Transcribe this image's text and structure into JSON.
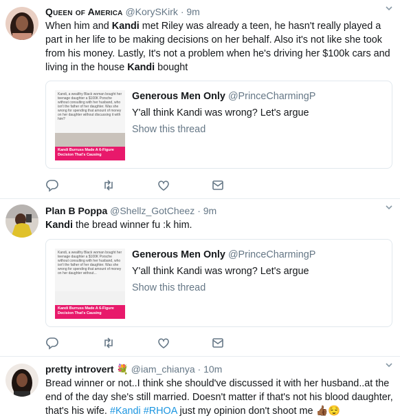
{
  "tweets": [
    {
      "name": "Queen of America",
      "handle": "@KorySKirk",
      "dot": "·",
      "time": "9m",
      "text_parts": [
        "When him and ",
        "Kandi",
        " met Riley was already a teen, he hasn't really played a part in her life to be making decisions on her behalf. Also it's not like she took from his money. Lastly, It's not a problem when he's driving her $100k cars and living in the house ",
        "Kandi",
        " bought"
      ],
      "quote": {
        "name": "Generous Men Only",
        "handle": "@PrinceCharmingP",
        "text": "Y'all think Kandi was wrong? Let's argue",
        "thread_link": "Show this thread",
        "thumb_text": "Kandi, a wealthy Black woman bought her teenage daughter a $100K Porsche without consulting with her husband, who isn't the father of her daughter. Was she wrong for spending that amount of money on her daughter without discussing it with him?",
        "thumb_banner": "Kandi Burruss Made A 6-Figure Decision That's Causing"
      }
    },
    {
      "name": "Plan B Poppa",
      "handle": "@Shellz_GotCheez",
      "dot": "·",
      "time": "9m",
      "text_parts": [
        "Kandi",
        " the bread winner fu :k him."
      ],
      "quote": {
        "name": "Generous Men Only",
        "handle": "@PrinceCharmingP",
        "text": "Y'all think Kandi was wrong? Let's argue",
        "thread_link": "Show this thread",
        "thumb_text": "Kandi, a wealthy Black woman bought her teenage daughter a $100K Porsche without consulting with her husband, who isn't the father of her daughter. Was she wrong for spending that amount of money on her daughter without...",
        "thumb_banner": "Kandi Burruss Made A 6-Figure Decision That's Causing"
      }
    },
    {
      "name": "pretty introvert",
      "emoji": "💐",
      "handle": "@iam_chianya",
      "dot": "·",
      "time": "10m",
      "text_parts": [
        "Bread winner or not..I think she should've discussed it with her husband..at the end of the day she's still married. Doesn't matter if that's not his blood daughter, that's his wife. ",
        "#Kandi",
        " ",
        "#RHOA",
        " just my opinion don't shoot me ",
        "👍🏾😌"
      ]
    }
  ],
  "icons": [
    "reply-icon",
    "retweet-icon",
    "like-icon",
    "dm-icon",
    "chevron-down-icon"
  ],
  "colors": {
    "link": "#1b95e0",
    "muted": "#657786",
    "border": "#e1e8ed",
    "banner": "#e8196b"
  }
}
